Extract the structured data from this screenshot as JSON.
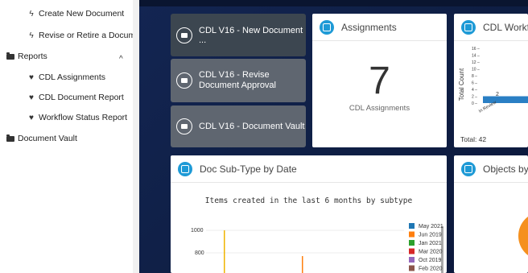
{
  "sidebar": {
    "items": [
      {
        "label": "Create New Document",
        "icon": "bolt-icon"
      },
      {
        "label": "Revise or Retire a Document",
        "icon": "bolt-icon"
      },
      {
        "label": "Reports",
        "icon": "folder-icon"
      },
      {
        "label": "CDL Assignments",
        "icon": "lightbulb-icon"
      },
      {
        "label": "CDL Document Report",
        "icon": "lightbulb-icon"
      },
      {
        "label": "Workflow Status Report",
        "icon": "lightbulb-icon"
      },
      {
        "label": "Document Vault",
        "icon": "folder-icon"
      }
    ]
  },
  "tiles": [
    {
      "label": "CDL V16 - New Document ...",
      "color": "#3c4650"
    },
    {
      "label": "CDL V16 - Revise Document Approval",
      "color": "#5f6670"
    },
    {
      "label": "CDL V16 - Document Vault",
      "color": "#5f6670"
    }
  ],
  "assignments": {
    "title": "Assignments",
    "count": "7",
    "caption": "CDL Assignments"
  },
  "workflow": {
    "title": "CDL Workflo",
    "ylabel": "Total Count",
    "bar_value": "2",
    "category": "In Review",
    "total": "Total: 42",
    "chart_data": {
      "type": "bar",
      "categories": [
        "In Review"
      ],
      "values": [
        2
      ],
      "ylim": [
        0,
        16
      ],
      "yticks": [
        "16",
        "14",
        "12",
        "10",
        "8",
        "6",
        "4",
        "2",
        "0"
      ]
    }
  },
  "subtype": {
    "title": "Doc Sub-Type by Date",
    "chart_title": "Items created in the last 6 months by subtype",
    "chart_data": {
      "type": "bar",
      "yticks": [
        "1000",
        "800"
      ],
      "legend": [
        {
          "name": "May 2021",
          "color": "#1f77b4"
        },
        {
          "name": "Jun 2019",
          "color": "#ff7f0e"
        },
        {
          "name": "Jan 2021",
          "color": "#2ca02c"
        },
        {
          "name": "Mar 2020",
          "color": "#d62728"
        },
        {
          "name": "Oct 2019",
          "color": "#9467bd"
        },
        {
          "name": "Feb 2020",
          "color": "#8c564b"
        }
      ]
    }
  },
  "objects": {
    "title": "Objects by"
  }
}
